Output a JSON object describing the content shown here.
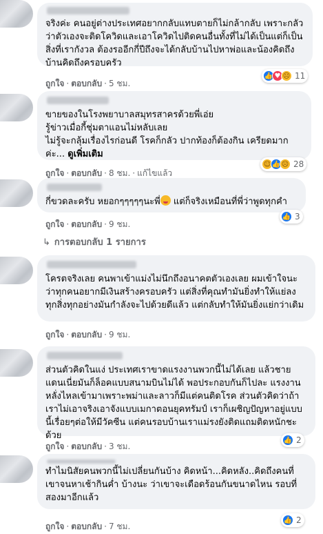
{
  "comments": [
    {
      "text": "จริงค่ะ คนอยู่ต่างประเทศอยากกลับแทบตายก็ไม่กล้ากลับ เพราะกลัวว่าตัวเองจะติดโควิดและเอาโควิดไปติดคนอื่นทั้งที่ไม่ได้เป็นแต่ก็เป็นสิ่งที่เรากังวล ต้องรออีกกี่ปีถึงจะได้กลับบ้านไปหาพ่อและน้องคิดถึงบ้านคิดถึงครอบครัว",
      "like": "ถูกใจ",
      "reply": "ตอบกลับ",
      "time": "5 ชม.",
      "reaction_count": "11",
      "reactions": [
        "like",
        "love",
        "sad"
      ]
    },
    {
      "text": "ขายของในโรงพยาบาลสมุทรสาครด้วยพี่เอ่ย\nรู้ข่าวเมื่อกี้ชุ่มตาแอนไม่หลับเลย\nไม่รู้จะกลุ้มเรื่องไรก่อนดี โรคก็กลัว ปากท้องก็ต้องกิน เครียดมากค่ะ...",
      "see_more": "ดูเพิ่มเติม",
      "like": "ถูกใจ",
      "reply": "ตอบกลับ",
      "time": "8 ชม.",
      "edited": "แก้ไขแล้ว",
      "reaction_count": "28",
      "reactions": [
        "haha",
        "like",
        "sad"
      ]
    },
    {
      "text": "กี่ขวดละครับ หยอกๆๆๆๆๆนะพี่",
      "text_after": " แต่ก็จริงเหมือนที่พี่ว่าพูดทุกคำ",
      "like": "ถูกใจ",
      "reply": "ตอบกลับ",
      "time": "9 ชม.",
      "reaction_count": "3",
      "reactions": [
        "like"
      ],
      "replies_link": "การตอบกลับ 1 รายการ"
    },
    {
      "text": "โครตจริงเลย คนพาเข้าแม่งไม่นึกถึงอนาคตตัวเองเลย ผมเข้าใจนะว่าทุกคนอยากมีเงินสร้างครอบครัว แต่สิ่งที่คุณทำมันยิ่งทำให้แย่ลง ทุกสิ่งทุกอย่างมันกำลังจะไปด้วยดีแล้ว แต่กลับทำให้มันยิ่งแย่กว่าเดิม",
      "like": "ถูกใจ",
      "reply": "ตอบกลับ",
      "time": "9 ชม."
    },
    {
      "text": "ส่วนตัวคิดในแง่ ประเทศเราขาดแรงงานพวกนี้ไม่ได้เลย แล้วชายแดนเนี่ยมันก็ล็อคแบบสนามบินไม่ได้ พอประกอบกันก็ไปละ แรงงานหลั่งไหลเข้ามาเพราะพม่าและลาวก็มีแต่คนติดโรค ส่วนตัวคิดว่าถ้าเราไม่เอาจริงเอาจังแบบเมกาตอนยุคทรัมป์ เราก็เผชิญปัญหาอยู่แบบนี้เรื่อยๆต่อให้มีวัคซีน แต่คนรอบบ้านเราแม่รงยังติดแถมติดหนักชะด้วย",
      "like": "ถูกใจ",
      "reply": "ตอบกลับ",
      "time": "3 ชม.",
      "reaction_count": "2",
      "reactions": [
        "like"
      ]
    },
    {
      "text": "ทำไมนิสัยคนพวกนี้ไม่เปลี่ยนกันบ้าง คิดหน้า...คิดหลัง..คิดถึงคนที่เขาจนหาเช้ากินค่ำ บ้างนะ ว่าเขาจะเดือดร้อนกันขนาดไหน รอบที่สองมาอีกแล้ว",
      "like": "ถูกใจ",
      "reply": "ตอบกลับ",
      "time": "7 ชม.",
      "reaction_count": "2",
      "reactions": [
        "like"
      ]
    }
  ]
}
